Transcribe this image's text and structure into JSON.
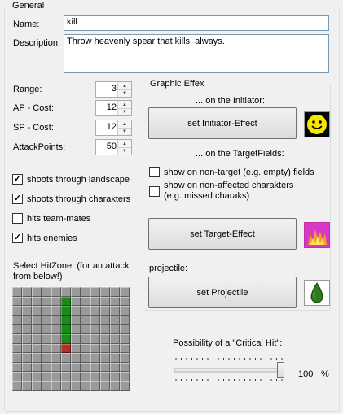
{
  "general": {
    "legend": "General",
    "name_label": "Name:",
    "name_value": "kill",
    "description_label": "Description:",
    "description_value": "Throw heavenly spear that kills. always."
  },
  "stats": {
    "range_label": "Range:",
    "range_value": "3",
    "ap_label": "AP - Cost:",
    "ap_value": "12",
    "sp_label": "SP - Cost:",
    "sp_value": "12",
    "attack_label": "AttackPoints:",
    "attack_value": "50"
  },
  "options": [
    {
      "label": "shoots through landscape",
      "checked": true
    },
    {
      "label": "shoots through charakters",
      "checked": true
    },
    {
      "label": "hits team-mates",
      "checked": false
    },
    {
      "label": "hits enemies",
      "checked": true
    }
  ],
  "hitzone": {
    "label": "Select HitZone: (for an attack from below!)"
  },
  "effex": {
    "legend": "Graphic Effex",
    "initiator_heading": "... on the Initiator:",
    "initiator_button": "set Initiator-Effect",
    "target_heading": "... on the TargetFields:",
    "nontarget_label": "show on non-target (e.g. empty) fields",
    "nonaffected_label": "show on non-affected charakters (e.g. missed charaks)",
    "target_button": "set Target-Effect",
    "projectile_label": "projectile:",
    "projectile_button": "set Projectile",
    "initiator_icon": "smiley-face-icon",
    "target_icon": "flame-icon",
    "projectile_icon": "green-drop-icon"
  },
  "critical": {
    "label": "Possibility of a \"Critical Hit\":",
    "value": "100",
    "unit": "%",
    "fraction": 1.0
  }
}
